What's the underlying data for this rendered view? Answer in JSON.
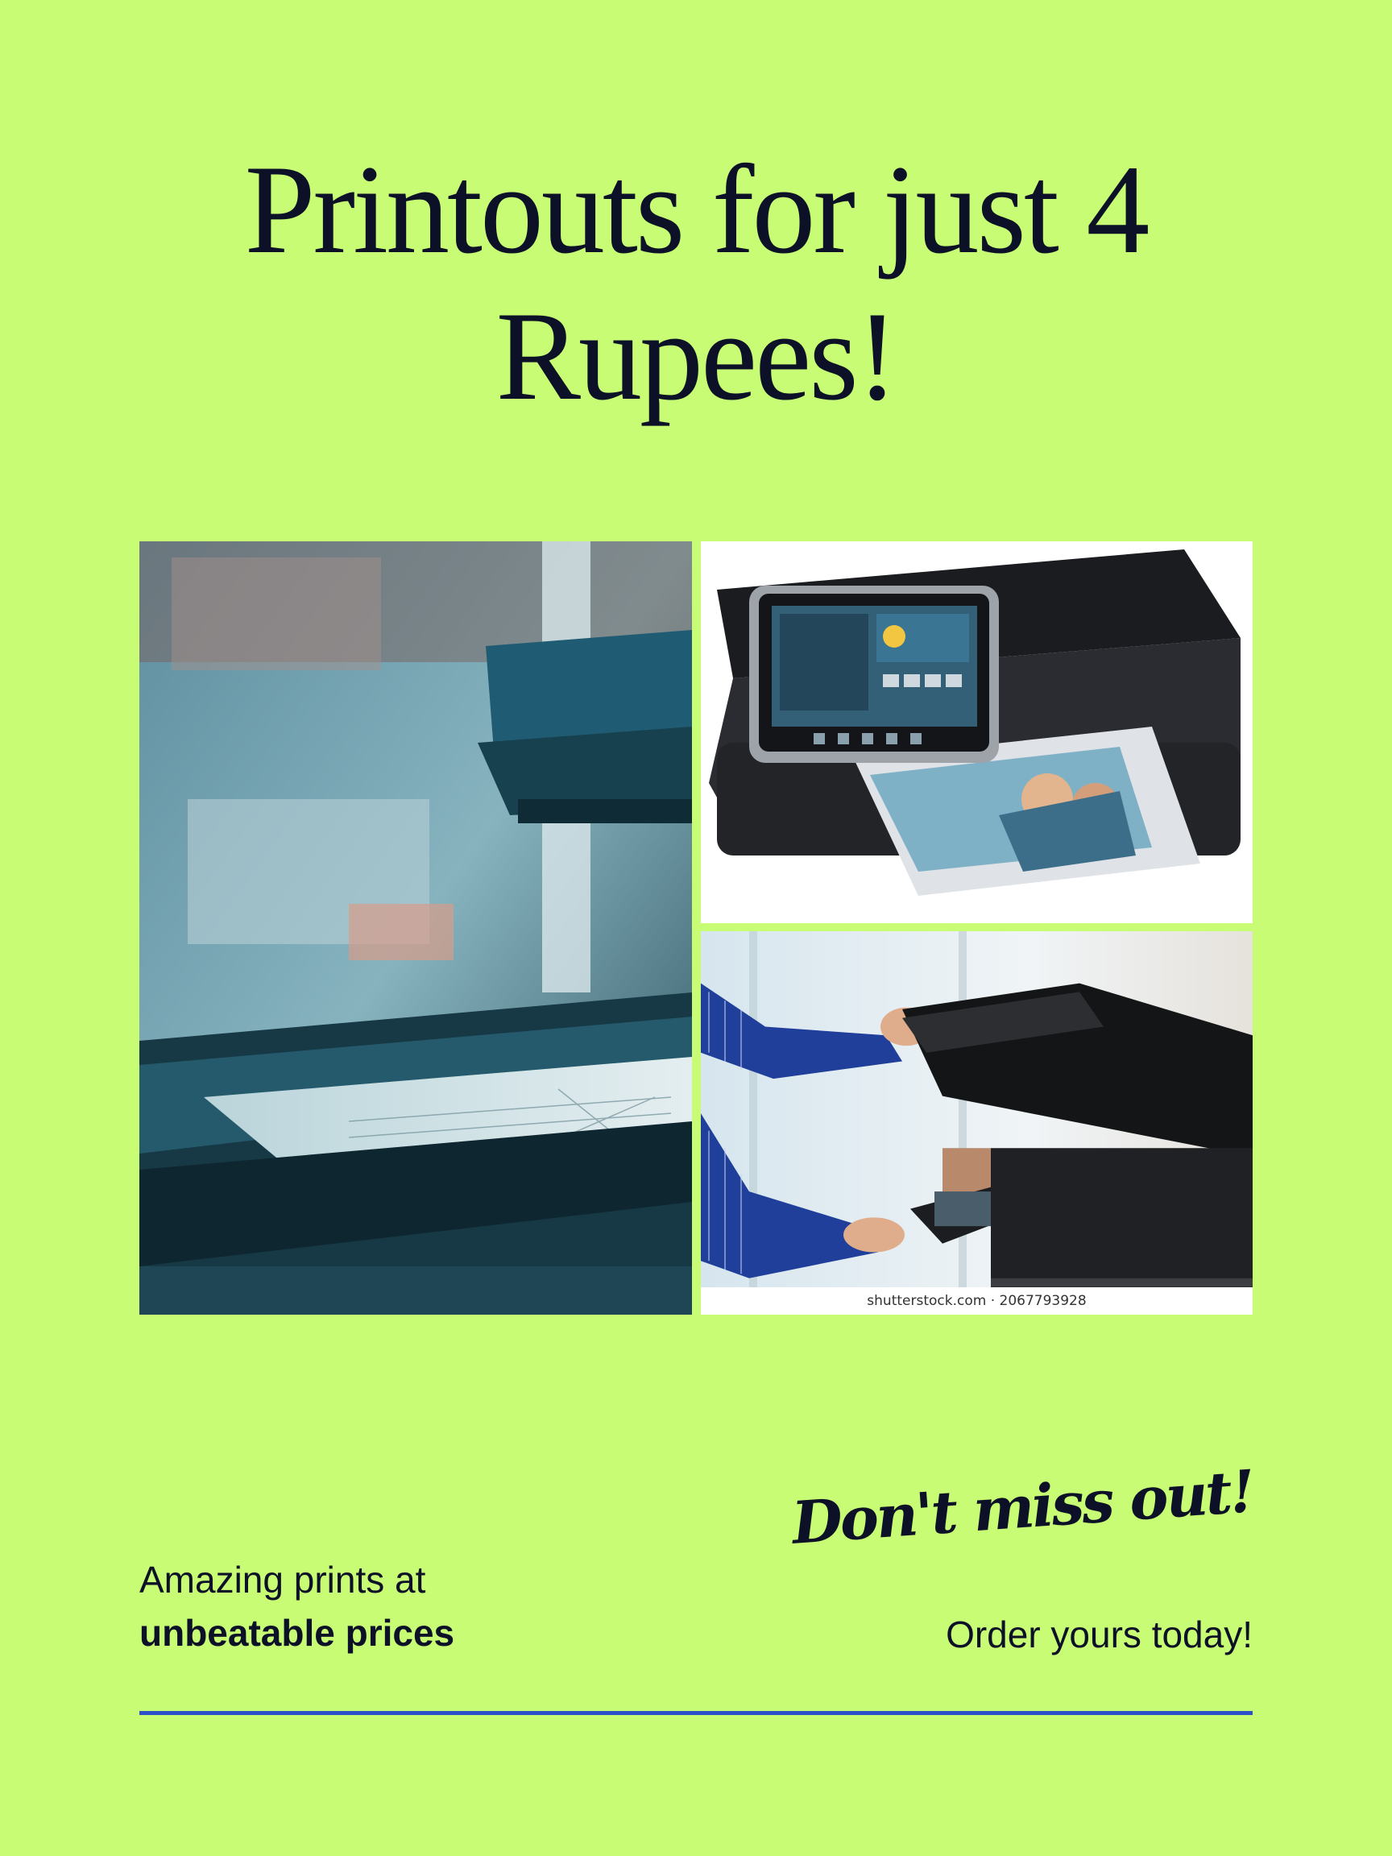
{
  "poster": {
    "headline_line1": "Printouts for just 4",
    "headline_line2": "Rupees!",
    "image_credit": "shutterstock.com · 2067793928",
    "tagline_line1": "Amazing prints at",
    "tagline_line2": "unbeatable prices",
    "cta_script": "Don't miss out!",
    "cta_order": "Order yours today!"
  },
  "colors": {
    "background": "#c7fc74",
    "text": "#0c1127",
    "divider": "#2b50c8"
  }
}
